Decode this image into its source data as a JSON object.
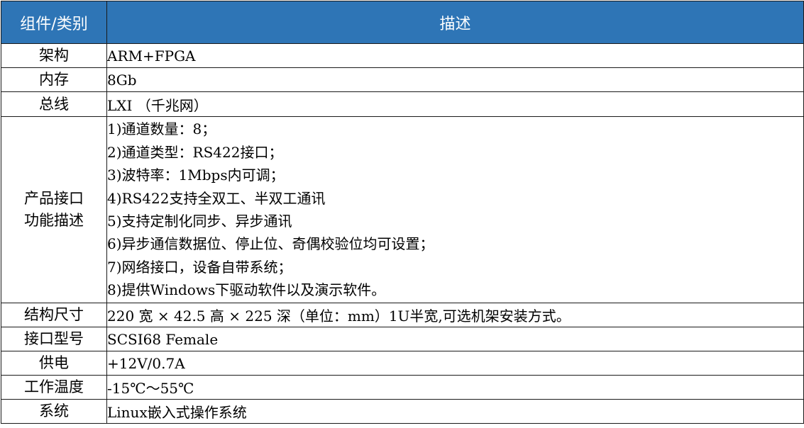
{
  "header": {
    "col1": "组件/类别",
    "col2": "描述"
  },
  "rows": [
    {
      "label": "架构",
      "value": "ARM+FPGA"
    },
    {
      "label": "内存",
      "value": "8Gb"
    },
    {
      "label": "总线",
      "value": "LXI （千兆网）"
    },
    {
      "label_lines": [
        "产品接口",
        "功能描述"
      ],
      "lines": [
        "1)通道数量：8；",
        "2)通道类型：RS422接口；",
        "3)波特率：1Mbps内可调；",
        "4)RS422支持全双工、半双工通讯",
        "5)支持定制化同步、异步通讯",
        "6)异步通信数据位、停止位、奇偶校验位均可设置；",
        "7)网络接口，设备自带系统；",
        "8)提供Windows下驱动软件以及演示软件。"
      ]
    },
    {
      "label": "结构尺寸",
      "value": "220 宽 × 42.5 高 × 225 深（单位：mm）1U半宽,可选机架安装方式。"
    },
    {
      "label": "接口型号",
      "value": "SCSI68 Female"
    },
    {
      "label": "供电",
      "value": "+12V/0.7A"
    },
    {
      "label": "工作温度",
      "value": "-15℃～55℃"
    },
    {
      "label": "系统",
      "value": "Linux嵌入式操作系统"
    }
  ],
  "colors": {
    "header_bg": "#2e75b6",
    "header_text": "#ffffff",
    "border": "#1a1a1a"
  }
}
